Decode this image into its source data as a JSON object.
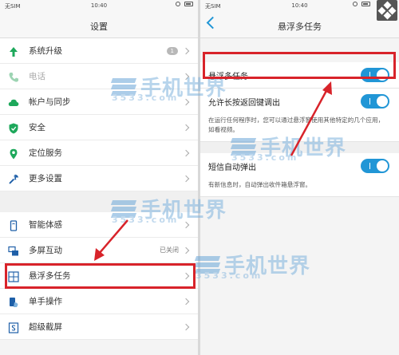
{
  "left": {
    "status": {
      "carrier": "无SIM",
      "time": "10:40"
    },
    "title": "设置",
    "items_top": [
      {
        "label": "系统升级",
        "badge": "1",
        "icon": "up-arrow-icon"
      },
      {
        "label": "电话",
        "icon": "phone-icon"
      },
      {
        "label": "帐户与同步",
        "icon": "cloud-icon"
      },
      {
        "label": "安全",
        "icon": "shield-icon"
      },
      {
        "label": "定位服务",
        "icon": "location-pin-icon"
      },
      {
        "label": "更多设置",
        "icon": "wrench-icon"
      }
    ],
    "items_bottom": [
      {
        "label": "智能体感",
        "icon": "gesture-icon"
      },
      {
        "label": "多屏互动",
        "value": "已关闭",
        "icon": "screen-mirror-icon"
      },
      {
        "label": "悬浮多任务",
        "icon": "floating-window-icon"
      },
      {
        "label": "单手操作",
        "icon": "one-hand-icon"
      },
      {
        "label": "超级截屏",
        "icon": "screenshot-icon"
      }
    ]
  },
  "right": {
    "status": {
      "carrier": "无SIM",
      "time": "10:40"
    },
    "title": "悬浮多任务",
    "settings": [
      {
        "label": "悬浮多任务",
        "on": true
      },
      {
        "label": "允许长按返回键调出",
        "on": true,
        "desc": "在运行任何程序时，您可以通过悬浮窗使用其他特定的几个应用，如看视频。"
      },
      {
        "label": "短信自动弹出",
        "on": true,
        "desc": "有新信息时，自动弹出收件箱悬浮窗。"
      }
    ]
  },
  "watermark": {
    "name": "手机世界",
    "domain": "3533.com"
  },
  "colors": {
    "accent": "#2196d6",
    "highlight": "#d8232a",
    "icon_green": "#1ea85b"
  }
}
